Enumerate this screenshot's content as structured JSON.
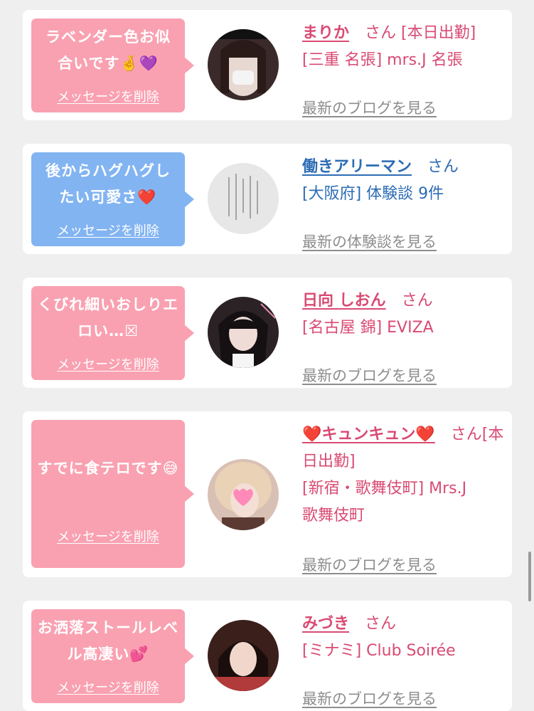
{
  "cards": [
    {
      "message": "ラベンダー色お似合いです🤞💜",
      "delete_label": "メッセージを削除",
      "name": "まりか",
      "san": "さん",
      "lines": [
        "[本日出勤]",
        "[三重 名張] mrs.J 名張"
      ],
      "more_label": "最新のブログを見る"
    },
    {
      "message": "後からハグハグしたい可愛さ❤️",
      "delete_label": "メッセージを削除",
      "name": "働きアリーマン",
      "san": "さん",
      "lines": [
        "[大阪府] 体験談 9件"
      ],
      "more_label": "最新の体験談を見る"
    },
    {
      "message": "くびれ細いおしりエロい…☒",
      "delete_label": "メッセージを削除",
      "name": "日向 しおん",
      "san": "さん",
      "lines": [
        "[名古屋 錦] EVIZA"
      ],
      "more_label": "最新のブログを見る"
    },
    {
      "message": "すでに食テロです😅",
      "delete_label": "メッセージを削除",
      "name": "❤️キュンキュン❤️",
      "san": "さん",
      "lines": [
        "[本日出勤]",
        "[新宿・歌舞伎町] Mrs.J",
        "歌舞伎町"
      ],
      "more_label": "最新のブログを見る"
    },
    {
      "message": "お洒落ストールレベル高凄い💕",
      "delete_label": "メッセージを削除",
      "name": "みづき",
      "san": "さん",
      "lines": [
        "[ミナミ] Club Soirée"
      ],
      "more_label": "最新のブログを見る"
    }
  ],
  "colors": {
    "pink_bubble": "#f9a1b1",
    "blue_bubble": "#82b4f2",
    "pink_text": "#d94a73",
    "blue_text": "#2c6cb4",
    "link_gray": "#8d8d8d",
    "background": "#efefef"
  }
}
